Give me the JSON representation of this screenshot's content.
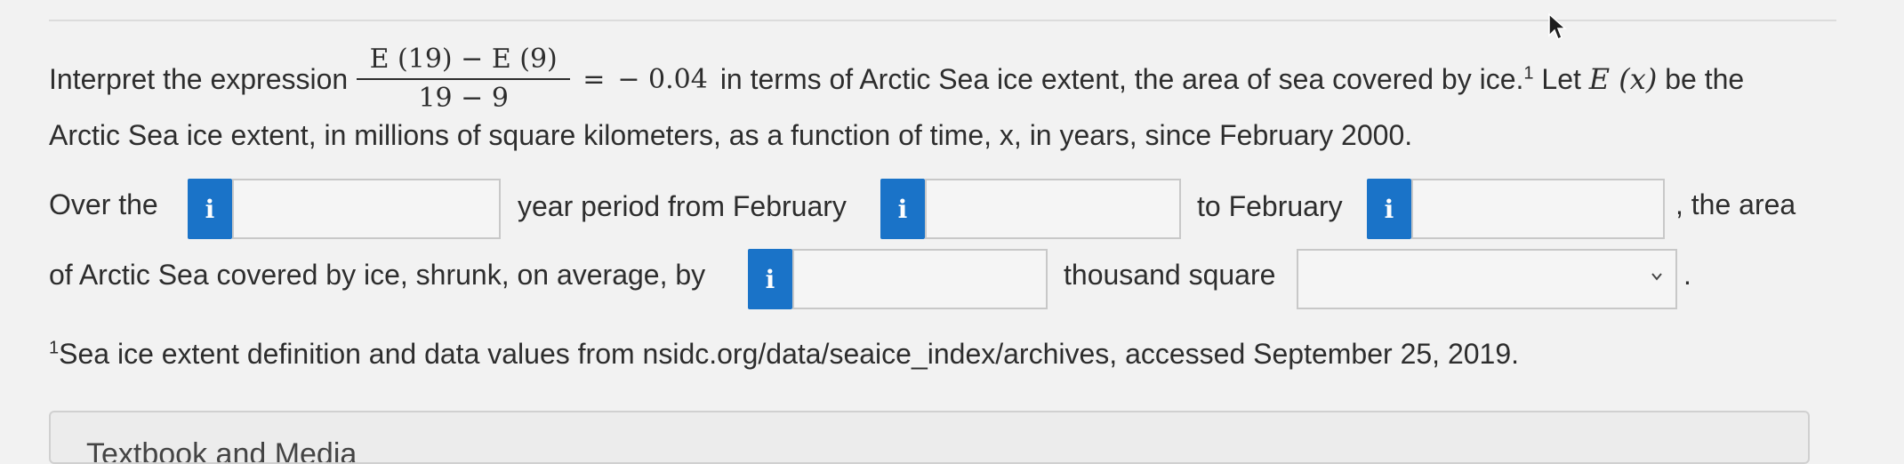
{
  "question": {
    "intro": "Interpret the expression",
    "fraction": {
      "numerator": "E (19) − E (9)",
      "denominator": "19 − 9"
    },
    "equals": "=",
    "value": "− 0.04",
    "after_value": "in terms of Arctic Sea ice extent, the area of sea covered by ice.",
    "sup_ref": "1",
    "let_text": "Let",
    "func": "E (x)",
    "be_the": "be the",
    "line2": "Arctic Sea ice extent, in millions of square kilometers, as a function of time, x, in years, since February 2000."
  },
  "fill_in": {
    "over_the": "Over the",
    "year_period": "year period from February",
    "to_february": "to February",
    "the_area": ", the area",
    "of_arctic": "of Arctic Sea covered by ice, shrunk, on average, by",
    "thousand_square": "thousand square",
    "period_end": ".",
    "info_icon_label": "i",
    "inputs": {
      "years": "",
      "start_year": "",
      "end_year": "",
      "amount": ""
    },
    "unit_select": {
      "selected": ""
    }
  },
  "footnote": {
    "sup": "1",
    "text": "Sea ice extent definition and data values from nsidc.org/data/seaice_index/archives, accessed September 25, 2019."
  },
  "panel": {
    "label": "Textbook and Media"
  },
  "colors": {
    "info_button": "#1a73c8",
    "background": "#f2f2f2",
    "text": "#2d2d2d"
  },
  "icons": {
    "cursor": "mouse-pointer-icon",
    "info": "info-icon",
    "dropdown": "chevron-down-icon"
  }
}
